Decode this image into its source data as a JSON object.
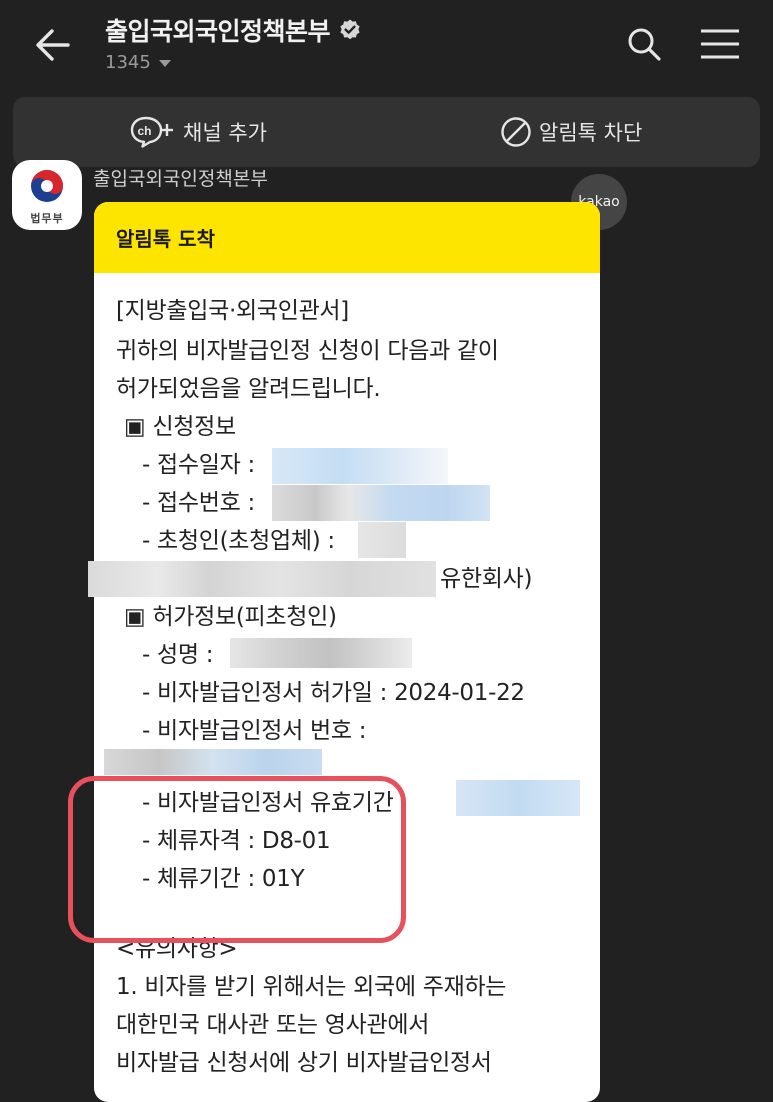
{
  "header": {
    "title": "출입국외국인정책본부",
    "subscriber_count": "1345"
  },
  "actions": {
    "add_channel": "채널 추가",
    "block_alimtalk": "알림톡 차단"
  },
  "sender": {
    "name": "출입국외국인정책본부",
    "avatar_label": "법무부",
    "kakao_badge": "kakao"
  },
  "message": {
    "header": "알림톡 도착",
    "lines": {
      "office": "[지방출입국·외국인관서]",
      "intro1": "귀하의 비자발급인정 신청이 다음과 같이",
      "intro2": "허가되었음을 알려드립니다.",
      "section_apply": "▣ 신청정보",
      "receipt_date": "- 접수일자 :",
      "receipt_no": "- 접수번호 :",
      "inviter": "- 초청인(초청업체) :",
      "company_suffix": "유한회사)",
      "section_permit": "▣ 허가정보(피초청인)",
      "name": "- 성명 :",
      "permit_date": "- 비자발급인정서 허가일 : 2024-01-22",
      "cert_no": "- 비자발급인정서 번호 :",
      "valid_period": "- 비자발급인정서 유효기간 :",
      "status": "- 체류자격 : D8-01",
      "period": "- 체류기간 : 01Y",
      "notice_title": "<유의사항>",
      "notice1": "1. 비자를 받기 위해서는 외국에 주재하는",
      "notice2": "대한민국 대사관 또는 영사관에서",
      "notice3": "비자발급 신청서에 상기 비자발급인정서"
    }
  },
  "colors": {
    "background": "#212121",
    "bubble_header": "#fee500",
    "highlight_box": "#e8505b"
  }
}
